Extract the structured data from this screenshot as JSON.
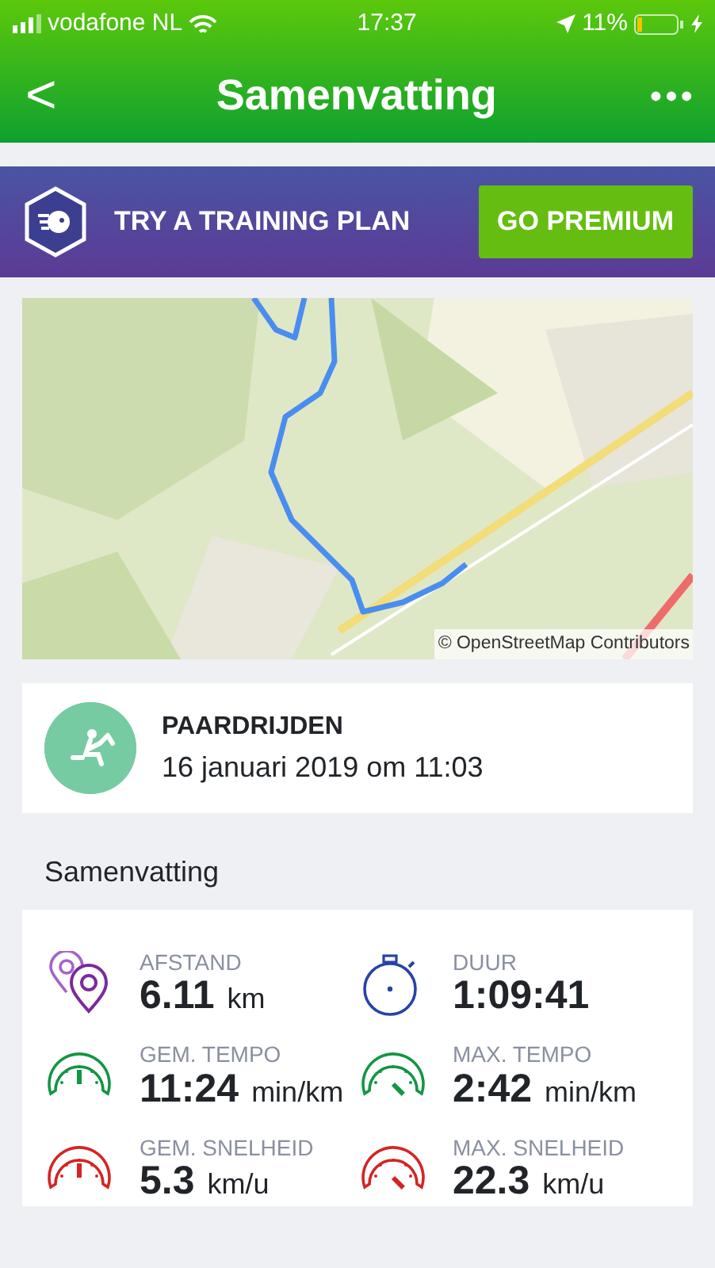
{
  "status_bar": {
    "carrier": "vodafone NL",
    "time": "17:37",
    "battery": "11%"
  },
  "nav": {
    "title": "Samenvatting",
    "back": "<",
    "more": "•••"
  },
  "promo": {
    "text": "TRY A TRAINING PLAN",
    "button": "GO PREMIUM"
  },
  "map": {
    "kind": "picture",
    "attribution": "© OpenStreetMap Contributors"
  },
  "activity": {
    "type": "PAARDRIJDEN",
    "date": "16 januari 2019 om 11:03"
  },
  "summary": {
    "heading": "Samenvatting",
    "stats": [
      {
        "kind": "distance",
        "label": "AFSTAND",
        "value": "6.11",
        "unit": "km"
      },
      {
        "kind": "duration",
        "label": "DUUR",
        "value": "1:09:41"
      },
      {
        "kind": "avg-pace",
        "label": "GEM. TEMPO",
        "value": "11:24",
        "unit": "min/km"
      },
      {
        "kind": "max-pace",
        "label": "MAX. TEMPO",
        "value": "2:42",
        "unit": "min/km"
      },
      {
        "kind": "avg-speed",
        "label": "GEM. SNELHEID",
        "value": "5.3",
        "unit": "km/u"
      },
      {
        "kind": "max-speed",
        "label": "MAX. SNELHEID",
        "value": "22.3",
        "unit": "km/u"
      }
    ]
  }
}
